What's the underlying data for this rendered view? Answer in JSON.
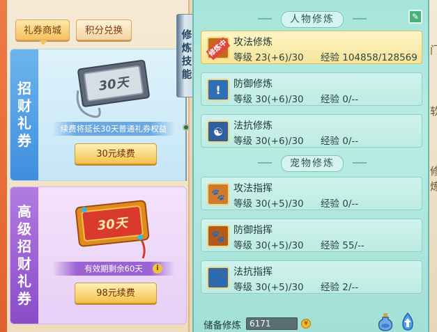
{
  "left": {
    "tabs": [
      "礼券商城",
      "积分兑换"
    ],
    "normal": {
      "band": [
        "招",
        "财",
        "礼",
        "券"
      ],
      "coupon_label": "30天",
      "desc": "续费将延长30天普通礼券权益",
      "button": "30元续费"
    },
    "premium": {
      "band": [
        "高",
        "级",
        "招",
        "财",
        "礼",
        "券"
      ],
      "coupon_label": "30天",
      "desc": "有效期剩余60天",
      "button": "98元续费"
    }
  },
  "vertical_tab": [
    "修",
    "炼",
    "技",
    "能"
  ],
  "right": {
    "character_header": "人物修炼",
    "pet_header": "宠物修炼",
    "level_label": "等级",
    "exp_label": "经验",
    "character_skills": [
      {
        "name": "攻法修炼",
        "level": "23(+6)/30",
        "exp": "104858/128569",
        "badge": "修炼中"
      },
      {
        "name": "防御修炼",
        "level": "30(+6)/30",
        "exp": "0/--"
      },
      {
        "name": "法抗修炼",
        "level": "30(+6)/30",
        "exp": "0/--"
      }
    ],
    "pet_skills": [
      {
        "name": "攻法指挥",
        "level": "30(+5)/30",
        "exp": "0/--"
      },
      {
        "name": "防御指挥",
        "level": "30(+5)/30",
        "exp": "55/--"
      },
      {
        "name": "法抗指挥",
        "level": "30(+5)/30",
        "exp": "2/--"
      }
    ],
    "reserve_label": "储备修炼",
    "reserve_value": "6171"
  },
  "right_edge_chars": [
    "门",
    "软",
    "修",
    "炼"
  ],
  "colors": {
    "active_row": "#f7e49a",
    "panel_teal": "#a6e4db",
    "button_gold": "#f4c24c"
  }
}
